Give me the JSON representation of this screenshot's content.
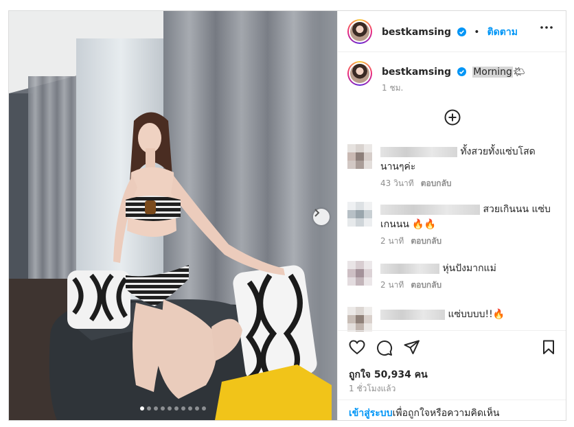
{
  "post": {
    "username": "bestkamsing",
    "follow_label": "ติดตาม",
    "bullet": "•",
    "caption": {
      "text": "Morning",
      "emoji": "🌤",
      "time": "1 ชม."
    },
    "comments": [
      {
        "text": "ทั้งสวยทั้งแซ่บโสด นานๆค่ะ",
        "time": "43 วินาที",
        "reply": "ตอบกลับ"
      },
      {
        "text": "สวยเกินนน แซ่บ เกนนน 🔥🔥",
        "time": "2 นาที",
        "reply": "ตอบกลับ"
      },
      {
        "text": "หุ่นปังมากแม่",
        "time": "2 นาที",
        "reply": "ตอบกลับ"
      },
      {
        "text": "แซ่บบบบ!!🔥",
        "time": "",
        "reply": ""
      }
    ],
    "likes_text": "ถูกใจ 50,934 คน",
    "posted_ago": "1 ชั่วโมงแล้ว",
    "login_link": "เข้าสู่ระบบ",
    "login_suffix": "เพื่อถูกใจหรือความคิดเห็น",
    "carousel": {
      "total": 10,
      "active_index": 0
    },
    "colors": {
      "accent": "#0095f6",
      "text": "#262626",
      "muted": "#8e8e8e",
      "verified": "#0095f6"
    }
  }
}
